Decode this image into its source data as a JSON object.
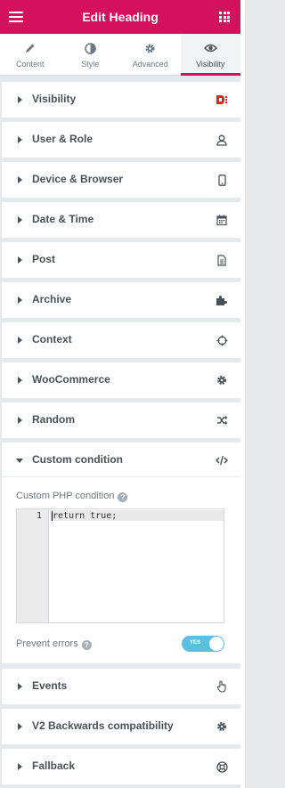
{
  "header": {
    "title": "Edit Heading"
  },
  "tabs": [
    {
      "label": "Content",
      "icon": "pencil-icon",
      "active": false
    },
    {
      "label": "Style",
      "icon": "half-circle-icon",
      "active": false
    },
    {
      "label": "Advanced",
      "icon": "gear-icon",
      "active": false
    },
    {
      "label": "Visibility",
      "icon": "eye-icon",
      "active": true
    }
  ],
  "sections": [
    {
      "label": "Visibility",
      "icon": "visibility-logo-icon"
    },
    {
      "label": "User & Role",
      "icon": "user-icon"
    },
    {
      "label": "Device & Browser",
      "icon": "mobile-icon"
    },
    {
      "label": "Date & Time",
      "icon": "calendar-icon"
    },
    {
      "label": "Post",
      "icon": "document-icon"
    },
    {
      "label": "Archive",
      "icon": "puzzle-icon"
    },
    {
      "label": "Context",
      "icon": "crosshair-icon"
    },
    {
      "label": "WooCommerce",
      "icon": "gear-icon"
    },
    {
      "label": "Random",
      "icon": "shuffle-icon"
    },
    {
      "label": "Custom condition",
      "icon": "code-icon"
    },
    {
      "label": "Events",
      "icon": "hand-pointer-icon"
    },
    {
      "label": "V2 Backwards compatibility",
      "icon": "gear-icon"
    },
    {
      "label": "Fallback",
      "icon": "lifebuoy-icon"
    }
  ],
  "custom": {
    "php_label": "Custom PHP condition",
    "line_number": "1",
    "code": "return true;",
    "prevent_label": "Prevent errors",
    "toggle_text": "YES",
    "toggle_on": true
  },
  "colors": {
    "brand": "#d5115e",
    "toggle": "#5bc0de",
    "visibility_logo": "#e2231a"
  }
}
